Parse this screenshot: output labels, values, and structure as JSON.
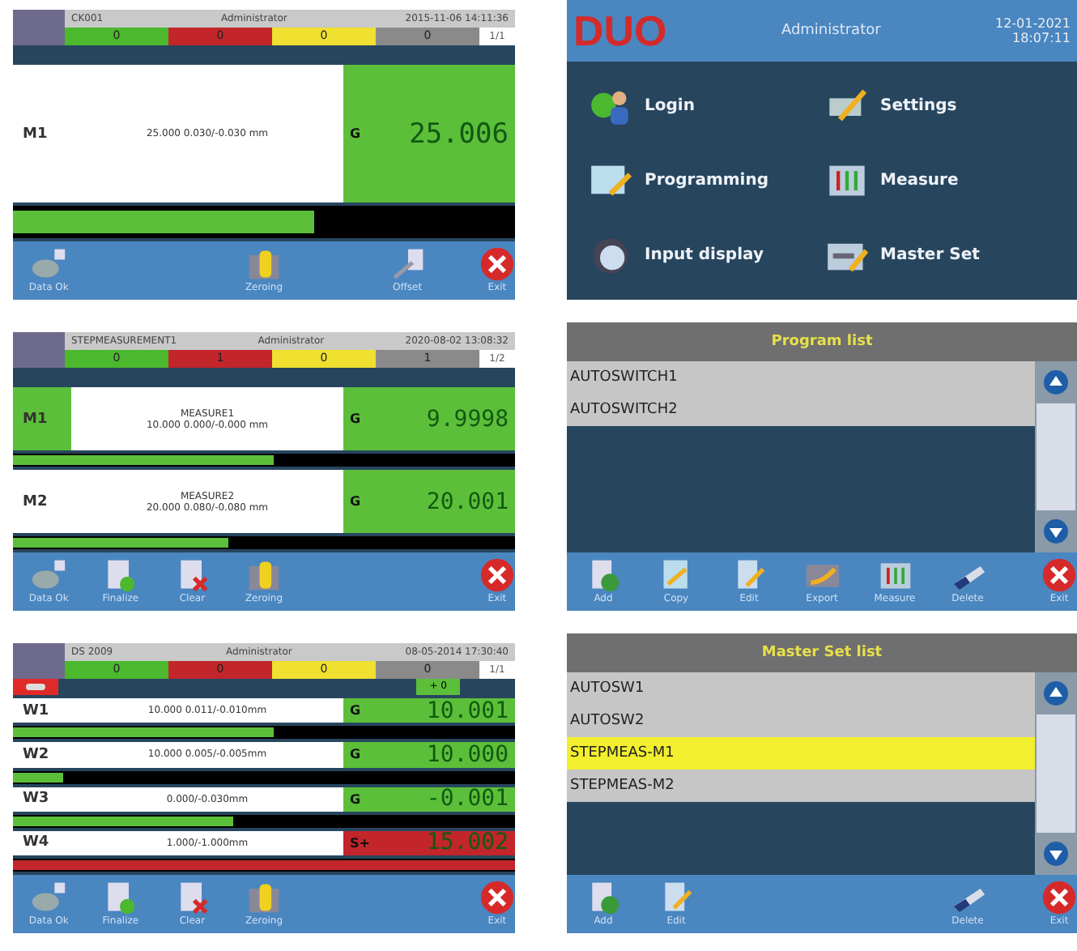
{
  "panels": [
    {
      "kind": "measure",
      "header": {
        "program": "CK001",
        "user": "Administrator",
        "date": "2015-11-06 14:11:36",
        "page": "1/1",
        "counters": [
          {
            "value": "0",
            "color": "#4cb82e"
          },
          {
            "value": "0",
            "color": "#c2262b"
          },
          {
            "value": "0",
            "color": "#f0e030"
          },
          {
            "value": "0",
            "color": "#8a8a8a"
          }
        ]
      },
      "rows": [
        {
          "label": "M1",
          "selected": false,
          "name": "",
          "tolerance": "25.000 0.030/-0.030 mm",
          "grade": "G",
          "value": "25.006",
          "level": 0.6,
          "color": "#5cbf3a"
        }
      ],
      "toolbar": [
        {
          "kind": "data-ok",
          "label": "Data Ok"
        },
        {
          "kind": "zeroing",
          "label": "Zeroing"
        },
        {
          "kind": "offset",
          "label": "Offset"
        },
        {
          "kind": "exit",
          "label": "Exit"
        }
      ]
    },
    {
      "kind": "menu",
      "logo": "DUO",
      "user": "Administrator",
      "date": "12-01-2021",
      "time": "18:07:11",
      "items": [
        {
          "kind": "login",
          "label": "Login"
        },
        {
          "kind": "settings",
          "label": "Settings"
        },
        {
          "kind": "programming",
          "label": "Programming"
        },
        {
          "kind": "measure",
          "label": "Measure"
        },
        {
          "kind": "input",
          "label": "Input display"
        },
        {
          "kind": "master",
          "label": "Master Set"
        }
      ]
    },
    {
      "kind": "measure",
      "header": {
        "program": "STEPMEASUREMENT1",
        "user": "Administrator",
        "date": "2020-08-02 13:08:32",
        "page": "1/2",
        "counters": [
          {
            "value": "0",
            "color": "#4cb82e"
          },
          {
            "value": "1",
            "color": "#c2262b"
          },
          {
            "value": "0",
            "color": "#f0e030"
          },
          {
            "value": "1",
            "color": "#8a8a8a"
          }
        ]
      },
      "rows": [
        {
          "label": "M1",
          "selected": true,
          "name": "MEASURE1",
          "tolerance": "10.000 0.000/-0.000 mm",
          "grade": "G",
          "value": "9.9998",
          "level": 0.52,
          "color": "#5cbf3a"
        },
        {
          "label": "M2",
          "selected": false,
          "name": "MEASURE2",
          "tolerance": "20.000 0.080/-0.080 mm",
          "grade": "G",
          "value": "20.001",
          "level": 0.43,
          "color": "#5cbf3a"
        }
      ],
      "toolbar": [
        {
          "kind": "data-ok",
          "label": "Data Ok"
        },
        {
          "kind": "finalize",
          "label": "Finalize"
        },
        {
          "kind": "clear",
          "label": "Clear"
        },
        {
          "kind": "zeroing",
          "label": "Zeroing"
        },
        {
          "kind": "exit",
          "label": "Exit"
        }
      ]
    },
    {
      "kind": "list",
      "title": "Program list",
      "items": [
        {
          "label": "AUTOSWITCH1",
          "selected": false
        },
        {
          "label": "AUTOSWITCH2",
          "selected": false
        }
      ],
      "toolbar": [
        {
          "kind": "add",
          "label": "Add"
        },
        {
          "kind": "copy",
          "label": "Copy"
        },
        {
          "kind": "edit",
          "label": "Edit"
        },
        {
          "kind": "export",
          "label": "Export"
        },
        {
          "kind": "measure",
          "label": "Measure"
        },
        {
          "kind": "delete",
          "label": "Delete"
        },
        {
          "kind": "exit",
          "label": "Exit"
        }
      ]
    },
    {
      "kind": "measure",
      "header": {
        "program": "DS 2009",
        "user": "Administrator",
        "date": "08-05-2014 17:30:40",
        "page": "1/1",
        "counters": [
          {
            "value": "0",
            "color": "#4cb82e"
          },
          {
            "value": "0",
            "color": "#c2262b"
          },
          {
            "value": "0",
            "color": "#f0e030"
          },
          {
            "value": "0",
            "color": "#8a8a8a"
          }
        ]
      },
      "indicator": {
        "badge": "+ 0"
      },
      "rows": [
        {
          "label": "W1",
          "selected": false,
          "name": "",
          "tolerance": "10.000 0.011/-0.010mm",
          "grade": "G",
          "value": "10.001",
          "level": 0.52,
          "color": "#5cbf3a"
        },
        {
          "label": "W2",
          "selected": false,
          "name": "",
          "tolerance": "10.000 0.005/-0.005mm",
          "grade": "G",
          "value": "10.000",
          "level": 0.1,
          "color": "#5cbf3a"
        },
        {
          "label": "W3",
          "selected": false,
          "name": "",
          "tolerance": "0.000/-0.030mm",
          "grade": "G",
          "value": "-0.001",
          "level": 0.44,
          "color": "#5cbf3a"
        },
        {
          "label": "W4",
          "selected": false,
          "name": "",
          "tolerance": "1.000/-1.000mm",
          "grade": "S+",
          "value": "15.002",
          "level": 1,
          "color": "#c2262b"
        }
      ],
      "toolbar": [
        {
          "kind": "data-ok",
          "label": "Data Ok"
        },
        {
          "kind": "finalize",
          "label": "Finalize"
        },
        {
          "kind": "clear",
          "label": "Clear"
        },
        {
          "kind": "zeroing",
          "label": "Zeroing"
        },
        {
          "kind": "exit",
          "label": "Exit"
        }
      ]
    },
    {
      "kind": "list",
      "title": "Master Set list",
      "items": [
        {
          "label": "AUTOSW1",
          "selected": false
        },
        {
          "label": "AUTOSW2",
          "selected": false
        },
        {
          "label": "STEPMEAS-M1",
          "selected": true
        },
        {
          "label": "STEPMEAS-M2",
          "selected": false
        }
      ],
      "toolbar": [
        {
          "kind": "add",
          "label": "Add"
        },
        {
          "kind": "edit",
          "label": "Edit"
        },
        {
          "kind": "delete",
          "label": "Delete"
        },
        {
          "kind": "exit",
          "label": "Exit"
        }
      ]
    }
  ]
}
